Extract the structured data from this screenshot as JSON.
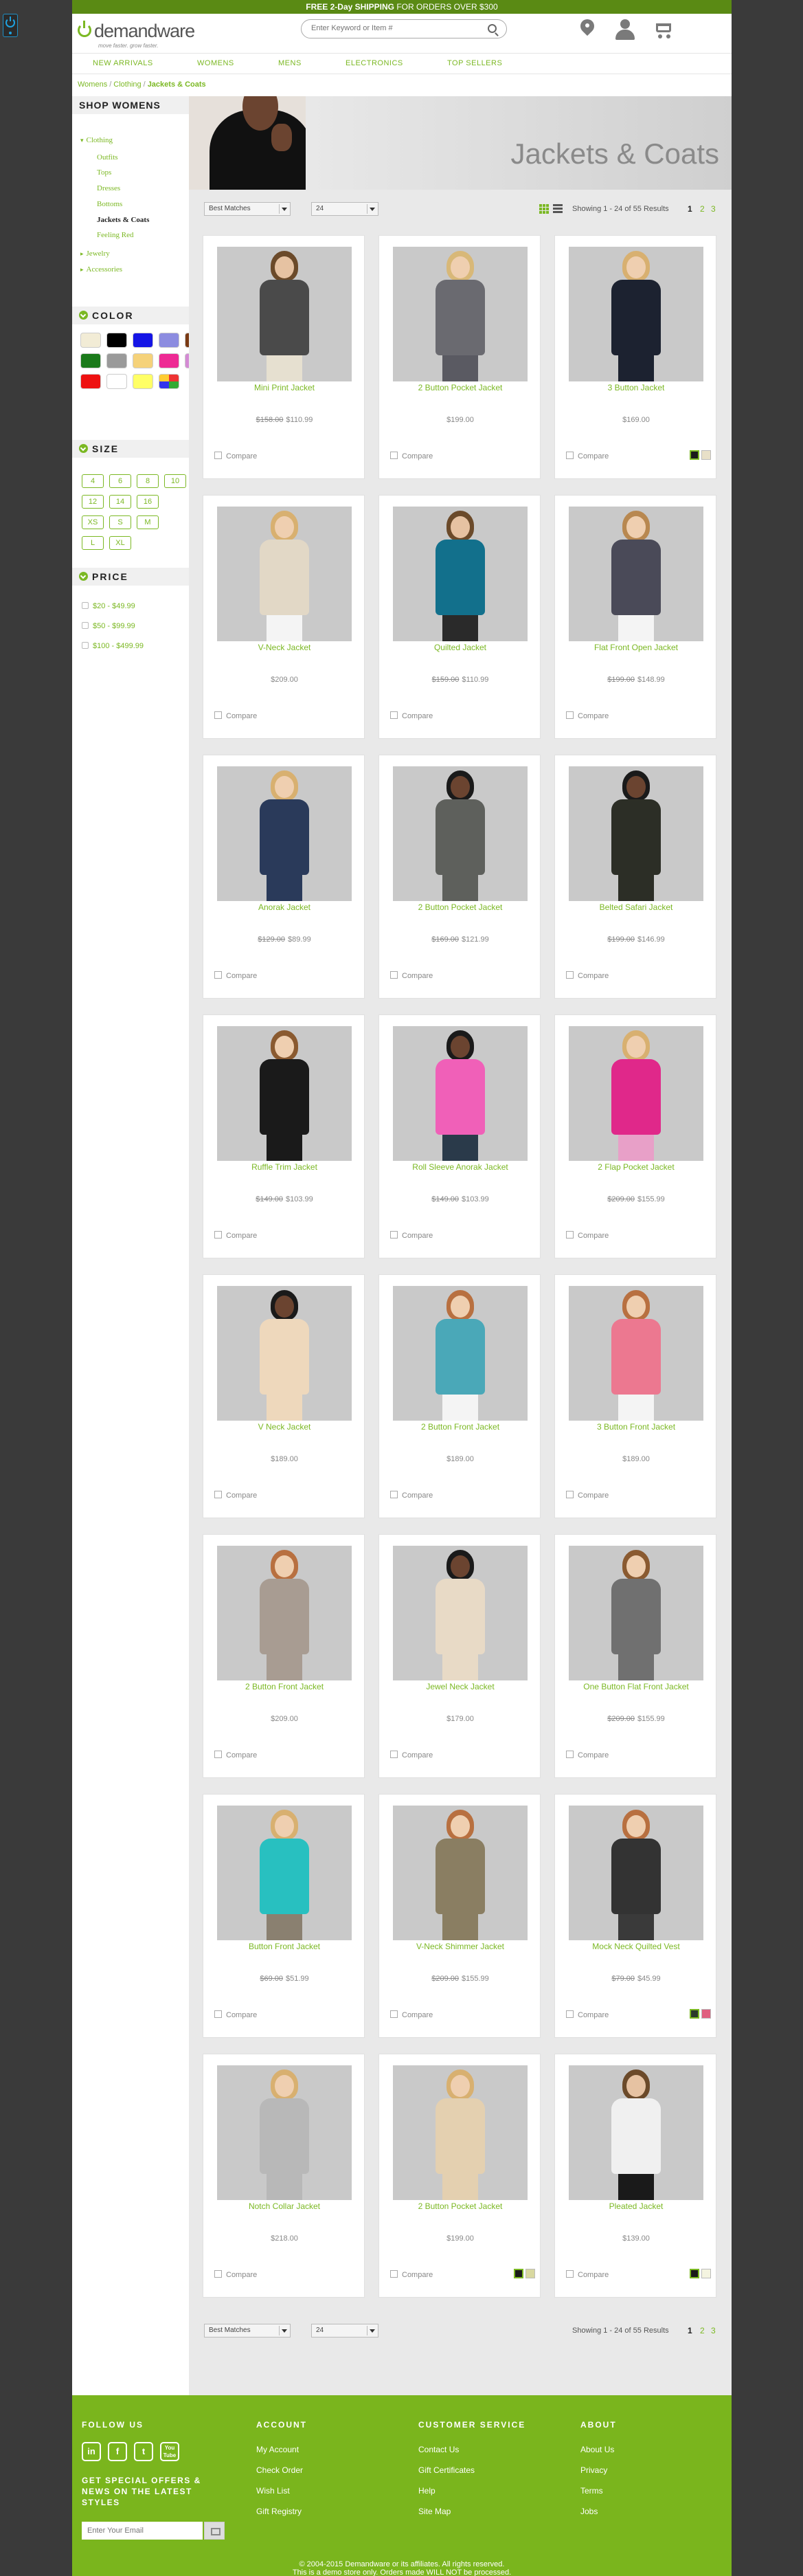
{
  "promo": {
    "bold": "FREE 2-Day SHIPPING",
    "rest": " FOR ORDERS OVER $300"
  },
  "header": {
    "logo_name": "demandware",
    "logo_tagline": "move faster. grow faster.",
    "search_placeholder": "Enter Keyword or Item #",
    "cart_count": "0",
    "icons": [
      "map-pin-icon",
      "user-icon",
      "cart-icon",
      "search-icon"
    ]
  },
  "nav": [
    "NEW ARRIVALS",
    "WOMENS",
    "MENS",
    "ELECTRONICS",
    "TOP SELLERS"
  ],
  "breadcrumb": [
    "Womens",
    "Clothing",
    "Jackets & Coats"
  ],
  "sidebar": {
    "title": "SHOP WOMENS",
    "categories": [
      {
        "label": "Clothing",
        "level": 1,
        "open": true
      },
      {
        "label": "Outfits",
        "level": 2
      },
      {
        "label": "Tops",
        "level": 2
      },
      {
        "label": "Dresses",
        "level": 2
      },
      {
        "label": "Bottoms",
        "level": 2
      },
      {
        "label": "Jackets & Coats",
        "level": 2,
        "current": true
      },
      {
        "label": "Feeling Red",
        "level": 2
      },
      {
        "label": "Jewelry",
        "level": 1
      },
      {
        "label": "Accessories",
        "level": 1
      }
    ],
    "color_title": "COLOR",
    "colors": [
      "#f2ecd6",
      "#000000",
      "#1515e6",
      "#8c8ce0",
      "#7a3a14",
      "#1a7a1a",
      "#9a9a9a",
      "#f5d27a",
      "#ee2a94",
      "#d48ad4",
      "#ee1111",
      "#ffffff",
      "#ffff66",
      "multicolor"
    ],
    "size_title": "SIZE",
    "sizes": [
      "4",
      "6",
      "8",
      "10",
      "12",
      "14",
      "16",
      "XS",
      "S",
      "M",
      "L",
      "XL"
    ],
    "price_title": "PRICE",
    "prices": [
      "$20 - $49.99",
      "$50 - $99.99",
      "$100 - $499.99"
    ]
  },
  "banner_title": "Jackets & Coats",
  "toolbar": {
    "sort": "Best Matches",
    "per_page": "24",
    "showing": "Showing 1 - 24 of 55 Results",
    "pages": [
      "1",
      "2",
      "3"
    ]
  },
  "compare_label": "Compare",
  "products": [
    {
      "name": "Mini Print Jacket",
      "old": "$158.00",
      "price": "$110.99",
      "look": {
        "hair": "#6b4a2a",
        "skin": "#e6c2a2",
        "top": "#4a4a4a",
        "legs": "#e6e0d0"
      },
      "swatches": []
    },
    {
      "name": "2 Button Pocket Jacket",
      "old": "",
      "price": "$199.00",
      "look": {
        "hair": "#d8b878",
        "skin": "#efcfb0",
        "top": "#6a6a70",
        "legs": "#5a5a62"
      },
      "swatches": []
    },
    {
      "name": "3 Button Jacket",
      "old": "",
      "price": "$169.00",
      "look": {
        "hair": "#d8b070",
        "skin": "#efcfb0",
        "top": "#1c2230",
        "legs": "#1c2230"
      },
      "swatches": [
        "#1a1a1a",
        "#e8e0c8"
      ]
    },
    {
      "name": "V-Neck Jacket",
      "old": "",
      "price": "$209.00",
      "look": {
        "hair": "#d8b070",
        "skin": "#efcfb0",
        "top": "#e2d8c6",
        "legs": "#f4f4f4"
      },
      "swatches": []
    },
    {
      "name": "Quilted Jacket",
      "old": "$159.00",
      "price": "$110.99",
      "look": {
        "hair": "#6b4a2a",
        "skin": "#e6c2a2",
        "top": "#12708c",
        "legs": "#2a2a2a"
      },
      "swatches": []
    },
    {
      "name": "Flat Front Open Jacket",
      "old": "$199.00",
      "price": "$148.99",
      "look": {
        "hair": "#b88850",
        "skin": "#efcfb0",
        "top": "#4a4a58",
        "legs": "#f4f4f4"
      },
      "swatches": []
    },
    {
      "name": "Anorak Jacket",
      "old": "$129.00",
      "price": "$89.99",
      "look": {
        "hair": "#d8b070",
        "skin": "#efcfb0",
        "top": "#2a3a5a",
        "legs": "#2a3a5a"
      },
      "swatches": []
    },
    {
      "name": "2 Button Pocket Jacket",
      "old": "$169.00",
      "price": "$121.99",
      "look": {
        "hair": "#1a1a1a",
        "skin": "#6b4430",
        "top": "#5e605c",
        "legs": "#5e605c"
      },
      "swatches": []
    },
    {
      "name": "Belted Safari Jacket",
      "old": "$199.00",
      "price": "$146.99",
      "look": {
        "hair": "#1a1a1a",
        "skin": "#6b4430",
        "top": "#2c2e26",
        "legs": "#2c2e26"
      },
      "swatches": []
    },
    {
      "name": "Ruffle Trim Jacket",
      "old": "$149.00",
      "price": "$103.99",
      "look": {
        "hair": "#8a5a30",
        "skin": "#efcfb0",
        "top": "#1a1a1a",
        "legs": "#1a1a1a"
      },
      "swatches": []
    },
    {
      "name": "Roll Sleeve Anorak Jacket",
      "old": "$149.00",
      "price": "$103.99",
      "look": {
        "hair": "#1a1a1a",
        "skin": "#6b4430",
        "top": "#f060b8",
        "legs": "#2a3a4a"
      },
      "swatches": []
    },
    {
      "name": "2 Flap Pocket Jacket",
      "old": "$209.00",
      "price": "$155.99",
      "look": {
        "hair": "#d8b070",
        "skin": "#efcfb0",
        "top": "#e0288a",
        "legs": "#e8a0c8"
      },
      "swatches": []
    },
    {
      "name": "V Neck Jacket",
      "old": "",
      "price": "$189.00",
      "look": {
        "hair": "#1a1a1a",
        "skin": "#6b4430",
        "top": "#eed8bc",
        "legs": "#eed8bc"
      },
      "swatches": []
    },
    {
      "name": "2 Button Front Jacket",
      "old": "",
      "price": "$189.00",
      "look": {
        "hair": "#b87040",
        "skin": "#efcfb0",
        "top": "#4aa8b8",
        "legs": "#f4f4f4"
      },
      "swatches": []
    },
    {
      "name": "3 Button Front Jacket",
      "old": "",
      "price": "$189.00",
      "look": {
        "hair": "#b87040",
        "skin": "#efcfb0",
        "top": "#ec7890",
        "legs": "#f4f4f4"
      },
      "swatches": []
    },
    {
      "name": "2 Button Front Jacket",
      "old": "",
      "price": "$209.00",
      "look": {
        "hair": "#b87040",
        "skin": "#efcfb0",
        "top": "#a89c92",
        "legs": "#a89c92"
      },
      "swatches": []
    },
    {
      "name": "Jewel Neck Jacket",
      "old": "",
      "price": "$179.00",
      "look": {
        "hair": "#1a1a1a",
        "skin": "#6b4430",
        "top": "#e8dac6",
        "legs": "#e8dac6"
      },
      "swatches": []
    },
    {
      "name": "One Button Flat Front Jacket",
      "old": "$209.00",
      "price": "$155.99",
      "look": {
        "hair": "#8a5a30",
        "skin": "#efcfb0",
        "top": "#707070",
        "legs": "#707070"
      },
      "swatches": []
    },
    {
      "name": "Button Front Jacket",
      "old": "$69.00",
      "price": "$51.99",
      "look": {
        "hair": "#d8b070",
        "skin": "#efcfb0",
        "top": "#28c0c0",
        "legs": "#8a8070"
      },
      "swatches": []
    },
    {
      "name": "V-Neck Shimmer Jacket",
      "old": "$209.00",
      "price": "$155.99",
      "look": {
        "hair": "#b87040",
        "skin": "#efcfb0",
        "top": "#8a7e62",
        "legs": "#8a7e62"
      },
      "swatches": []
    },
    {
      "name": "Mock Neck Quilted Vest",
      "old": "$79.00",
      "price": "$45.99",
      "look": {
        "hair": "#b87040",
        "skin": "#efcfb0",
        "top": "#333333",
        "legs": "#3a3a3a"
      },
      "swatches": [
        "#2a3a2a",
        "#e06080"
      ]
    },
    {
      "name": "Notch Collar Jacket",
      "old": "",
      "price": "$218.00",
      "look": {
        "hair": "#d8b070",
        "skin": "#efcfb0",
        "top": "#b8b8b8",
        "legs": "#b8b8b8"
      },
      "swatches": []
    },
    {
      "name": "2 Button Pocket Jacket",
      "old": "",
      "price": "$199.00",
      "look": {
        "hair": "#d8b070",
        "skin": "#efcfb0",
        "top": "#e4d0b0",
        "legs": "#e4d0b0"
      },
      "swatches": [
        "#1a1a1a",
        "#d8d8a0"
      ]
    },
    {
      "name": "Pleated Jacket",
      "old": "",
      "price": "$139.00",
      "look": {
        "hair": "#6b4a2a",
        "skin": "#e6c2a2",
        "top": "#f0f0f0",
        "legs": "#1a1a1a"
      },
      "swatches": [
        "#1a1a1a",
        "#f4f4e0"
      ]
    }
  ],
  "footer": {
    "follow_title": "FOLLOW US",
    "social": [
      "in",
      "f",
      "t",
      "You Tube"
    ],
    "newsletter": "GET SPECIAL OFFERS & NEWS ON THE LATEST STYLES",
    "email_placeholder": "Enter Your Email",
    "account_title": "ACCOUNT",
    "account_links": [
      "My Account",
      "Check Order",
      "Wish List",
      "Gift Registry"
    ],
    "service_title": "CUSTOMER SERVICE",
    "service_links": [
      "Contact Us",
      "Gift Certificates",
      "Help",
      "Site Map"
    ],
    "about_title": "ABOUT",
    "about_links": [
      "About Us",
      "Privacy",
      "Terms",
      "Jobs"
    ],
    "copyright1": "© 2004-2015 Demandware or its affiliates. All rights reserved.",
    "copyright2": "This is a demo store only. Orders made WILL NOT be processed."
  }
}
